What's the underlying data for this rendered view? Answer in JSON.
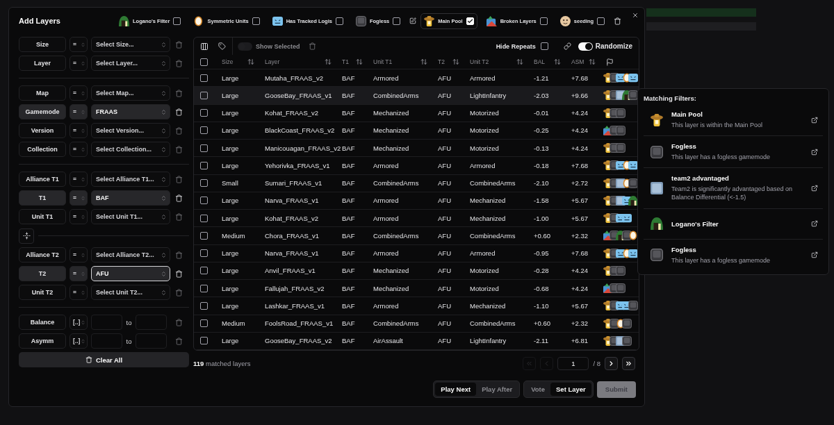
{
  "dialog": {
    "title": "Add Layers",
    "filter_chips": [
      {
        "kind": "logano",
        "label": "Logano's Filter",
        "checked": false
      },
      {
        "kind": "symmetric",
        "label": "Symmetric Units",
        "checked": false
      },
      {
        "kind": "tracked-logis",
        "label": "Has Tracked Logis",
        "checked": false
      },
      {
        "kind": "fogless",
        "label": "Fogless",
        "checked": false
      }
    ],
    "pool_chips": [
      {
        "kind": "main-pool",
        "label": "Main Pool",
        "checked": true
      },
      {
        "kind": "broken",
        "label": "Broken Layers",
        "checked": false
      },
      {
        "kind": "seeding",
        "label": "seeding",
        "checked": false
      }
    ]
  },
  "filters": [
    {
      "kind": "select",
      "field": "Size",
      "operator": "=",
      "placeholder": "Select Size...",
      "active": false,
      "focused": false
    },
    {
      "kind": "select",
      "field": "Layer",
      "operator": "=",
      "placeholder": "Select Layer...",
      "active": false,
      "focused": false
    },
    {
      "kind": "divider"
    },
    {
      "kind": "select",
      "field": "Map",
      "operator": "=",
      "placeholder": "Select Map...",
      "active": false,
      "focused": false
    },
    {
      "kind": "select",
      "field": "Gamemode",
      "operator": "=",
      "value": "FRAAS",
      "active": true,
      "focused": false
    },
    {
      "kind": "select",
      "field": "Version",
      "operator": "=",
      "placeholder": "Select Version...",
      "active": false,
      "focused": false
    },
    {
      "kind": "select",
      "field": "Collection",
      "operator": "=",
      "placeholder": "Select Collection...",
      "active": false,
      "focused": false
    },
    {
      "kind": "divider"
    },
    {
      "kind": "select",
      "field": "Alliance T1",
      "operator": "=",
      "placeholder": "Select Alliance T1...",
      "active": false,
      "focused": false
    },
    {
      "kind": "select",
      "field": "T1",
      "operator": "=",
      "value": "BAF",
      "active": true,
      "focused": false
    },
    {
      "kind": "select",
      "field": "Unit T1",
      "operator": "=",
      "placeholder": "Select Unit T1...",
      "active": false,
      "focused": false
    },
    {
      "kind": "swap"
    },
    {
      "kind": "select",
      "field": "Alliance T2",
      "operator": "=",
      "placeholder": "Select Alliance T2...",
      "active": false,
      "focused": false
    },
    {
      "kind": "select",
      "field": "T2",
      "operator": "=",
      "value": "AFU",
      "active": true,
      "focused": true
    },
    {
      "kind": "select",
      "field": "Unit T2",
      "operator": "=",
      "placeholder": "Select Unit T2...",
      "active": false,
      "focused": false
    },
    {
      "kind": "divider"
    },
    {
      "kind": "range",
      "field": "Balance",
      "operator": "[..]",
      "joiner": "to",
      "active": false
    },
    {
      "kind": "range",
      "field": "Asymm",
      "operator": "[..]",
      "joiner": "to",
      "active": false
    }
  ],
  "clear_all": "Clear All",
  "table": {
    "toolbar": {
      "show_selected": {
        "label": "Show Selected",
        "on": false
      },
      "hide_repeats": {
        "label": "Hide Repeats",
        "checked": false
      },
      "randomize": {
        "label": "Randomize",
        "on": true
      }
    },
    "select_all_checked": false,
    "columns": [
      "Size",
      "Layer",
      "T1",
      "Unit T1",
      "T2",
      "Unit T2",
      "BAL",
      "ASM"
    ],
    "rows": [
      {
        "cells": [
          "Large",
          "Mutaha_FRAAS_v2",
          "BAF",
          "Armored",
          "AFU",
          "Armored",
          "-1.21",
          "+7.68"
        ],
        "checked": false,
        "hovered": false,
        "badges": [
          {
            "kind": "main-pool"
          },
          {
            "kind": "fogless"
          },
          {
            "kind": "tracked-logis"
          },
          {
            "kind": "symmetric"
          },
          {
            "kind": "tracked-logis"
          }
        ]
      },
      {
        "cells": [
          "Large",
          "GooseBay_FRAAS_v1",
          "BAF",
          "CombinedArms",
          "AFU",
          "LightInfantry",
          "-2.03",
          "+9.66"
        ],
        "checked": false,
        "hovered": true,
        "badges": [
          {
            "kind": "main-pool"
          },
          {
            "kind": "fogless"
          },
          {
            "kind": "team2"
          },
          {
            "kind": "logano"
          },
          {
            "kind": "fogless"
          }
        ]
      },
      {
        "cells": [
          "Large",
          "Kohat_FRAAS_v2",
          "BAF",
          "Mechanized",
          "AFU",
          "Motorized",
          "-0.01",
          "+4.24"
        ],
        "checked": false,
        "hovered": false,
        "badges": [
          {
            "kind": "main-pool"
          },
          {
            "kind": "fogless"
          },
          {
            "kind": "fogless"
          }
        ]
      },
      {
        "cells": [
          "Large",
          "BlackCoast_FRAAS_v2",
          "BAF",
          "Mechanized",
          "AFU",
          "Motorized",
          "-0.25",
          "+4.24"
        ],
        "checked": false,
        "hovered": false,
        "badges": [
          {
            "kind": "broken"
          },
          {
            "kind": "fogless"
          },
          {
            "kind": "fogless"
          }
        ]
      },
      {
        "cells": [
          "Large",
          "Manicouagan_FRAAS_v2",
          "BAF",
          "Mechanized",
          "AFU",
          "Motorized",
          "-0.13",
          "+4.24"
        ],
        "checked": false,
        "hovered": false,
        "badges": [
          {
            "kind": "main-pool"
          },
          {
            "kind": "fogless"
          },
          {
            "kind": "fogless"
          }
        ]
      },
      {
        "cells": [
          "Large",
          "Yehorivka_FRAAS_v1",
          "BAF",
          "Armored",
          "AFU",
          "Armored",
          "-0.18",
          "+7.68"
        ],
        "checked": false,
        "hovered": false,
        "badges": [
          {
            "kind": "main-pool"
          },
          {
            "kind": "fogless"
          },
          {
            "kind": "tracked-logis"
          },
          {
            "kind": "symmetric"
          },
          {
            "kind": "tracked-logis"
          }
        ]
      },
      {
        "cells": [
          "Small",
          "Sumari_FRAAS_v1",
          "BAF",
          "CombinedArms",
          "AFU",
          "CombinedArms",
          "-2.10",
          "+2.72"
        ],
        "checked": false,
        "hovered": false,
        "badges": [
          {
            "kind": "main-pool"
          },
          {
            "kind": "fogless"
          },
          {
            "kind": "team2"
          },
          {
            "kind": "symmetric"
          },
          {
            "kind": "fogless"
          }
        ]
      },
      {
        "cells": [
          "Large",
          "Narva_FRAAS_v1",
          "BAF",
          "Armored",
          "AFU",
          "Mechanized",
          "-1.58",
          "+5.67"
        ],
        "checked": false,
        "hovered": false,
        "badges": [
          {
            "kind": "main-pool"
          },
          {
            "kind": "fogless"
          },
          {
            "kind": "team2"
          },
          {
            "kind": "tracked-logis"
          },
          {
            "kind": "logano"
          }
        ]
      },
      {
        "cells": [
          "Large",
          "Kohat_FRAAS_v2",
          "BAF",
          "Armored",
          "AFU",
          "Mechanized",
          "-1.00",
          "+5.67"
        ],
        "checked": false,
        "hovered": false,
        "badges": [
          {
            "kind": "main-pool"
          },
          {
            "kind": "fogless"
          },
          {
            "kind": "tracked-logis"
          },
          {
            "kind": "tracked-logis"
          }
        ]
      },
      {
        "cells": [
          "Medium",
          "Chora_FRAAS_v1",
          "BAF",
          "CombinedArms",
          "AFU",
          "CombinedArms",
          "+0.60",
          "+2.32"
        ],
        "checked": false,
        "hovered": false,
        "badges": [
          {
            "kind": "broken"
          },
          {
            "kind": "fogless"
          },
          {
            "kind": "logano"
          },
          {
            "kind": "fogless"
          },
          {
            "kind": "symmetric"
          }
        ]
      },
      {
        "cells": [
          "Large",
          "Narva_FRAAS_v1",
          "BAF",
          "Armored",
          "AFU",
          "Armored",
          "-0.95",
          "+7.68"
        ],
        "checked": false,
        "hovered": false,
        "badges": [
          {
            "kind": "main-pool"
          },
          {
            "kind": "fogless"
          },
          {
            "kind": "tracked-logis"
          },
          {
            "kind": "symmetric"
          },
          {
            "kind": "tracked-logis"
          }
        ]
      },
      {
        "cells": [
          "Large",
          "Anvil_FRAAS_v1",
          "BAF",
          "Mechanized",
          "AFU",
          "Motorized",
          "-0.28",
          "+4.24"
        ],
        "checked": false,
        "hovered": false,
        "badges": [
          {
            "kind": "main-pool"
          },
          {
            "kind": "fogless"
          },
          {
            "kind": "fogless"
          }
        ]
      },
      {
        "cells": [
          "Large",
          "Fallujah_FRAAS_v2",
          "BAF",
          "Mechanized",
          "AFU",
          "Motorized",
          "-0.68",
          "+4.24"
        ],
        "checked": false,
        "hovered": false,
        "badges": [
          {
            "kind": "broken"
          },
          {
            "kind": "fogless"
          },
          {
            "kind": "fogless"
          }
        ]
      },
      {
        "cells": [
          "Large",
          "Lashkar_FRAAS_v1",
          "BAF",
          "Armored",
          "AFU",
          "Mechanized",
          "-1.10",
          "+5.67"
        ],
        "checked": false,
        "hovered": false,
        "badges": [
          {
            "kind": "main-pool"
          },
          {
            "kind": "fogless"
          },
          {
            "kind": "tracked-logis"
          },
          {
            "kind": "tracked-logis"
          },
          {
            "kind": "fogless"
          }
        ]
      },
      {
        "cells": [
          "Medium",
          "FoolsRoad_FRAAS_v1",
          "BAF",
          "CombinedArms",
          "AFU",
          "CombinedArms",
          "+0.60",
          "+2.32"
        ],
        "checked": false,
        "hovered": false,
        "badges": [
          {
            "kind": "main-pool"
          },
          {
            "kind": "fogless"
          },
          {
            "kind": "symmetric"
          },
          {
            "kind": "fogless"
          }
        ]
      },
      {
        "cells": [
          "Large",
          "GooseBay_FRAAS_v2",
          "BAF",
          "AirAssault",
          "AFU",
          "LightInfantry",
          "-2.11",
          "+6.81"
        ],
        "checked": false,
        "hovered": false,
        "badges": [
          {
            "kind": "main-pool"
          },
          {
            "kind": "fogless"
          },
          {
            "kind": "team2"
          },
          {
            "kind": "fogless"
          }
        ]
      }
    ]
  },
  "footer": {
    "count": "**119** matched layers",
    "pagination": {
      "nav": [
        {
          "kind": "first",
          "disabled": true
        },
        {
          "kind": "prev",
          "disabled": true
        },
        {
          "kind": "next",
          "disabled": false
        },
        {
          "kind": "last",
          "disabled": false
        }
      ],
      "page": "1",
      "total": "/ 8"
    }
  },
  "actions": {
    "queue_mode": [
      {
        "label": "Play Next",
        "selected": true
      },
      {
        "label": "Play After",
        "selected": false
      }
    ],
    "action_mode": [
      {
        "label": "Vote",
        "selected": false
      },
      {
        "label": "Set Layer",
        "selected": true
      }
    ],
    "submit": {
      "label": "Submit",
      "disabled": true
    }
  },
  "popup": {
    "title": "Matching Filters:",
    "items": [
      {
        "kind": "main-pool",
        "title": "Main Pool",
        "description": "This layer is within the Main Pool"
      },
      {
        "kind": "fogless",
        "title": "Fogless",
        "description": "This layer has a fogless gamemode"
      },
      {
        "kind": "team2",
        "title": "team2 advantaged",
        "description": "Team2 is significantly advantaged based on Balance Differential (<-1.5)"
      },
      {
        "kind": "logano",
        "title": "Logano's Filter"
      },
      {
        "kind": "fogless",
        "title": "Fogless",
        "description": "This layer has a fogless gamemode"
      }
    ]
  }
}
